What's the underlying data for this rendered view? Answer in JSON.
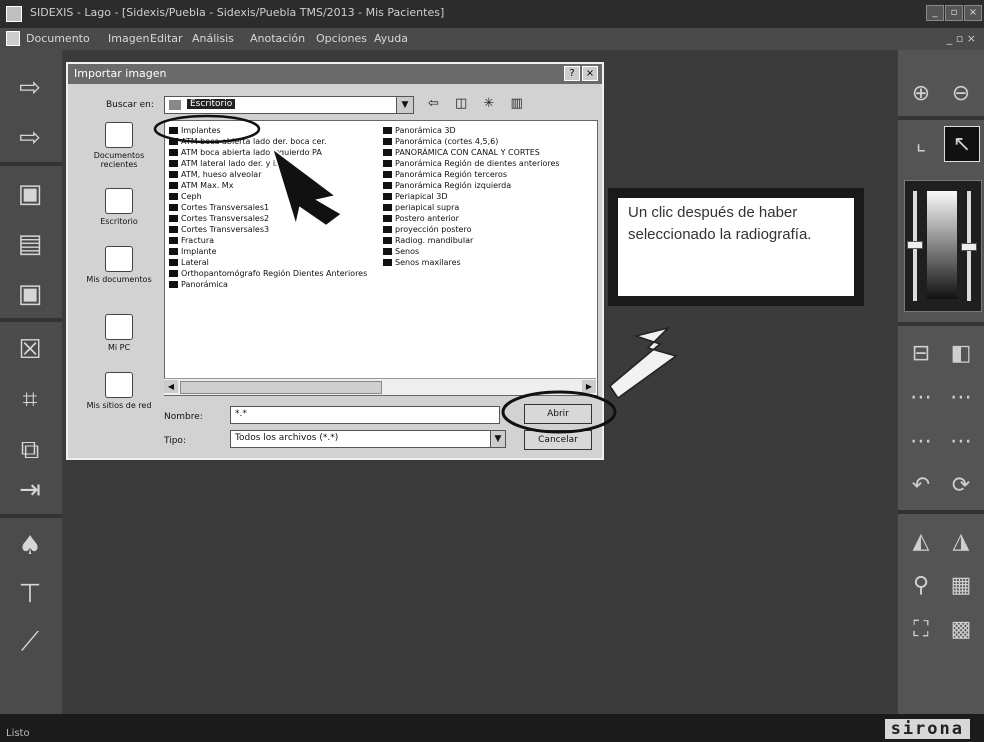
{
  "window": {
    "title": "SIDEXIS - Lago - [Sidexis/Puebla - Sidexis/Puebla TMS/2013 - Mis Pacientes]",
    "controls": [
      "_",
      "▫",
      "×"
    ]
  },
  "menubar": {
    "items": [
      "Documento",
      "Imagen",
      "Editar",
      "Análisis",
      "Anotación",
      "Opciones",
      "Ayuda"
    ],
    "mdi_controls": "_ ▫ ×"
  },
  "dialog": {
    "title": "Importar imagen",
    "title_buttons": [
      "?",
      "×"
    ],
    "look_in_label": "Buscar en:",
    "look_in_value": "Escritorio",
    "nav_icons": "⇦ ◫ ✳ ▥",
    "places": [
      {
        "label": "Documentos recientes"
      },
      {
        "label": "Escritorio"
      },
      {
        "label": "Mis documentos"
      },
      {
        "label": "Mi PC"
      },
      {
        "label": "Mis sitios de red"
      }
    ],
    "files_col1": [
      "Implantes",
      "ATM boca abierta lado der. boca cer.",
      "ATM boca abierta lado izquierdo PA",
      "ATM lateral lado der. y izq.",
      "ATM, hueso alveolar",
      "ATM Max. Mx",
      "Ceph",
      "Cortes Transversales1",
      "Cortes Transversales2",
      "Cortes Transversales3",
      "Fractura",
      "Implante",
      "Lateral",
      "Orthopantomógrafo Región Dientes Anteriores",
      "Panorámica"
    ],
    "files_col2": [
      "Panorámica 3D",
      "Panorámica (cortes 4,5,6)",
      "PANORÁMICA CON CANAL Y CORTES",
      "Panorámica Región de dientes anteriores",
      "Panorámica Región terceros",
      "Panorámica Región izquierda",
      "Periapical 3D",
      "periapical supra",
      "Postero anterior",
      "proyección postero",
      "Radiog. mandibular",
      "Senos",
      "Senos maxilares"
    ],
    "filename_label": "Nombre:",
    "filename_value": "*.*",
    "filetype_label": "Tipo:",
    "filetype_value": "Todos los archivos (*.*)",
    "open_button": "Abrir",
    "cancel_button": "Cancelar"
  },
  "annotation": {
    "text": "Un clic después de haber seleccionado la radiografía."
  },
  "statusbar": {
    "text": "Listo",
    "brand": "sirona"
  },
  "colors": {
    "workspace": "#3b3b3b",
    "toolbar": "#4b4b4b",
    "dialog": "#d2d2d2"
  }
}
